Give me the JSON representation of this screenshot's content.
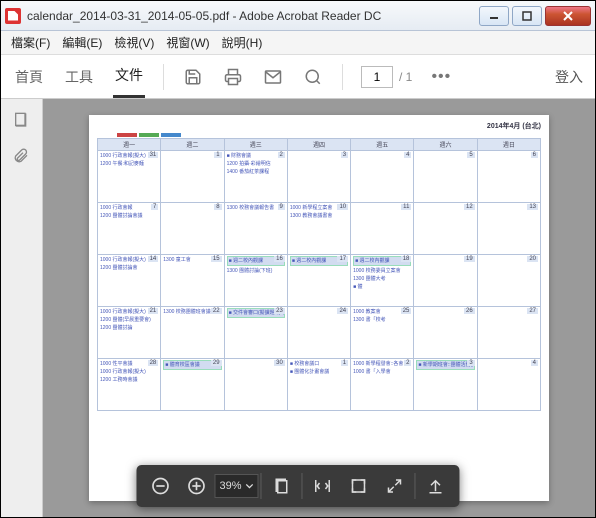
{
  "window": {
    "title": "calendar_2014-03-31_2014-05-05.pdf - Adobe Acrobat Reader DC"
  },
  "menus": [
    "檔案(F)",
    "編輯(E)",
    "檢視(V)",
    "視窗(W)",
    "說明(H)"
  ],
  "tabs": {
    "home": "首頁",
    "tools": "工具",
    "document": "文件"
  },
  "page_nav": {
    "current": "1",
    "total": "/ 1"
  },
  "more": "•••",
  "login": "登入",
  "zoom": "39%",
  "calendar": {
    "title": "2014年4月 (台北)",
    "headers": [
      "週一",
      "週二",
      "週三",
      "週四",
      "週五",
      "週六",
      "週日"
    ],
    "marks": [
      "#cc4444",
      "#55aa55",
      "#4488cc"
    ],
    "weeks": [
      [
        {
          "n": "31",
          "ev": [
            "1000  行政會報(擬大)",
            "1200  午餐:和記麥麵"
          ]
        },
        {
          "n": "1",
          "ev": []
        },
        {
          "n": "2",
          "ev": [
            "■ 財務會議",
            "1200  拍攝·彩繪明信",
            "1400  番茄紅茶課程"
          ]
        },
        {
          "n": "3",
          "ev": []
        },
        {
          "n": "4",
          "ev": []
        },
        {
          "n": "5",
          "ev": []
        },
        {
          "n": "6",
          "ev": []
        }
      ],
      [
        {
          "n": "7",
          "ev": [
            "1000  行政會報",
            "1200  團體討論會議"
          ]
        },
        {
          "n": "8",
          "ev": []
        },
        {
          "n": "9",
          "ev": [
            "1300  校務會議報告書"
          ]
        },
        {
          "n": "10",
          "ev": [
            "1000  新學程立案會",
            "1300  教務會議書會"
          ]
        },
        {
          "n": "11",
          "ev": []
        },
        {
          "n": "12",
          "ev": []
        },
        {
          "n": "13",
          "ev": []
        }
      ],
      [
        {
          "n": "14",
          "ev": [
            "1000  行政會報(擬大)",
            "1200  團體討論會"
          ]
        },
        {
          "n": "15",
          "ev": [
            "1300  童工會"
          ]
        },
        {
          "n": "16",
          "ev": [
            "■ 週二校內觀課",
            "1300  團體討論(下班)",
            "",
            "",
            ""
          ],
          "allday": true
        },
        {
          "n": "17",
          "ev": [
            "■ 週二校內觀課"
          ],
          "allday": true
        },
        {
          "n": "18",
          "ev": [
            "■ 週二校內觀課",
            "1000  校務委員立案會",
            "1300  團體大考",
            "■ 體",
            "",
            "",
            "",
            ""
          ],
          "allday": true
        },
        {
          "n": "19",
          "ev": []
        },
        {
          "n": "20",
          "ev": []
        }
      ],
      [
        {
          "n": "21",
          "ev": [
            "1000  行政會報(擬大)",
            "1200  團體(早晨重要會)",
            "1200  團體討論"
          ]
        },
        {
          "n": "22",
          "ev": [
            "1300  校務團體班會議"
          ]
        },
        {
          "n": "23",
          "ev": [
            "■ 交件會審口(擬課題:行政)"
          ],
          "allday": true
        },
        {
          "n": "24",
          "ev": []
        },
        {
          "n": "25",
          "ev": [
            "1000  教案會",
            "1300  書「校考"
          ]
        },
        {
          "n": "26",
          "ev": []
        },
        {
          "n": "27",
          "ev": []
        }
      ],
      [
        {
          "n": "28",
          "ev": [
            "1000  性平會議",
            "1000  行政會報(擬大)",
            "1200  工務時會議"
          ]
        },
        {
          "n": "29",
          "ev": [
            "■ 體育校區會議"
          ],
          "allday": true
        },
        {
          "n": "30",
          "ev": []
        },
        {
          "n": "1",
          "ev": [
            "■ 校務會議口",
            "■ 團體化計畫會議"
          ]
        },
        {
          "n": "2",
          "ev": [
            "1000  新學程發會::各會",
            "1000  書「入學會"
          ]
        },
        {
          "n": "3",
          "ev": [
            "■ 新學期班會::團體活動計畫"
          ],
          "allday": true
        },
        {
          "n": "4",
          "ev": []
        }
      ]
    ]
  }
}
